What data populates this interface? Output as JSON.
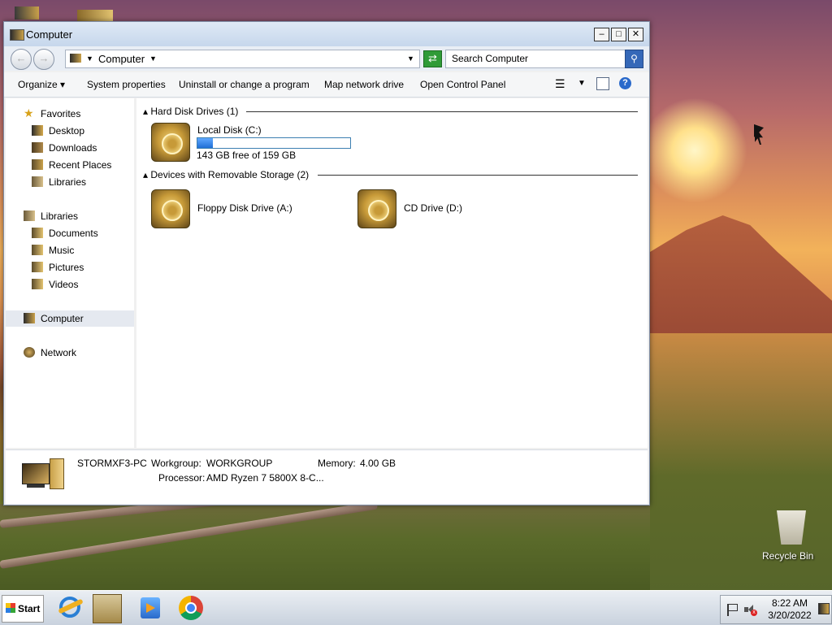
{
  "window": {
    "title": "Computer",
    "address": "Computer",
    "search_placeholder": "Search Computer"
  },
  "commands": [
    "Organize",
    "System properties",
    "Uninstall or change a program",
    "Map network drive",
    "Open Control Panel"
  ],
  "sidebar": {
    "favorites_label": "Favorites",
    "favorites": [
      "Desktop",
      "Downloads",
      "Recent Places",
      "Libraries"
    ],
    "libraries_label": "Libraries",
    "libraries": [
      "Documents",
      "Music",
      "Pictures",
      "Videos"
    ],
    "computer_label": "Computer",
    "network_label": "Network"
  },
  "groups": {
    "hard_disks": "Hard Disk Drives (1)",
    "removable": "Devices with Removable Storage (2)"
  },
  "drives": {
    "local_disk_label": "Local Disk (C:)",
    "local_disk_free": "143 GB free of 159 GB",
    "local_disk_used_fraction": 0.1,
    "floppy_label": "Floppy Disk Drive (A:)",
    "cd_label": "CD Drive (D:)"
  },
  "details": {
    "pc_name": "STORMXF3-PC",
    "workgroup_label": "Workgroup:",
    "workgroup_value": "WORKGROUP",
    "memory_label": "Memory:",
    "memory_value": "4.00 GB",
    "processor_label": "Processor:",
    "processor_value": "AMD Ryzen 7 5800X 8-C..."
  },
  "desktop": {
    "recycle_bin": "Recycle Bin"
  },
  "taskbar": {
    "start_label": "Start",
    "time": "8:22 AM",
    "date": "3/20/2022"
  }
}
